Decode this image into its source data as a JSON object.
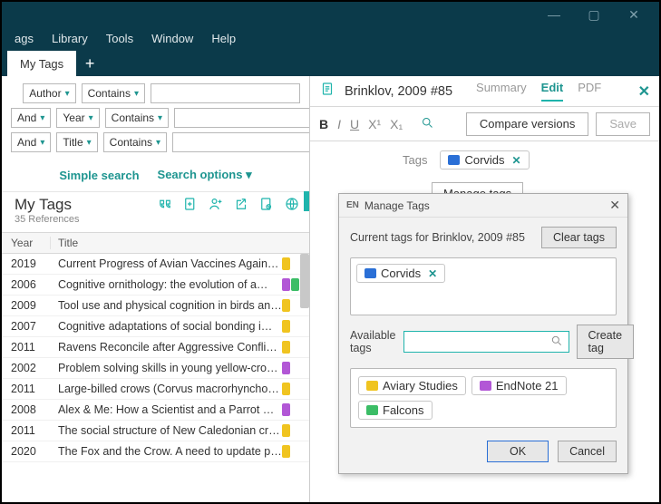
{
  "window_controls": {
    "min": "—",
    "max": "▢",
    "close": "✕"
  },
  "menubar": [
    "ags",
    "Library",
    "Tools",
    "Window",
    "Help"
  ],
  "tabs": {
    "active": "My Tags",
    "add": "+"
  },
  "search": {
    "rows": [
      {
        "op": "",
        "field": "Author",
        "cond": "Contains",
        "value": ""
      },
      {
        "op": "And",
        "field": "Year",
        "cond": "Contains",
        "value": ""
      },
      {
        "op": "And",
        "field": "Title",
        "cond": "Contains",
        "value": ""
      }
    ],
    "simple_label": "Simple search",
    "options_label": "Search options"
  },
  "group": {
    "title": "My Tags",
    "count": "35 References"
  },
  "table": {
    "headers": {
      "year": "Year",
      "title": "Title"
    },
    "rows": [
      {
        "year": "2019",
        "title": "Current Progress of Avian Vaccines Against …",
        "tags": [
          "#f0c420"
        ]
      },
      {
        "year": "2006",
        "title": "Cognitive ornithology: the evolution of a…",
        "tags": [
          "#b257d6",
          "#3bbd66"
        ]
      },
      {
        "year": "2009",
        "title": "Tool use and physical cognition in birds and…",
        "tags": [
          "#f0c420"
        ]
      },
      {
        "year": "2007",
        "title": "Cognitive adaptations of social bonding i…",
        "tags": [
          "#f0c420"
        ]
      },
      {
        "year": "2011",
        "title": "Ravens Reconcile after Aggressive Conflicts …",
        "tags": [
          "#f0c420"
        ]
      },
      {
        "year": "2002",
        "title": "Problem solving skills in young yellow-crow…",
        "tags": [
          "#b257d6"
        ]
      },
      {
        "year": "2011",
        "title": "Large-billed crows (Corvus macrorhynchos) …",
        "tags": [
          "#f0c420"
        ]
      },
      {
        "year": "2008",
        "title": "Alex & Me: How a Scientist and a Parrot Dis…",
        "tags": [
          "#b257d6"
        ]
      },
      {
        "year": "2011",
        "title": "The social structure of New Caledonian crows",
        "tags": [
          "#f0c420"
        ]
      },
      {
        "year": "2020",
        "title": "The Fox and the Crow. A need to update pe…",
        "tags": [
          "#f0c420"
        ]
      }
    ]
  },
  "detail": {
    "title": "Brinklov, 2009 #85",
    "tabs": [
      "Summary",
      "Edit",
      "PDF"
    ],
    "active_tab": "Edit",
    "format": {
      "bold": "B",
      "italic": "I",
      "under": "U",
      "sup": "X¹",
      "sub": "X₁"
    },
    "compare": "Compare versions",
    "save": "Save",
    "tags_label": "Tags",
    "current_tag": {
      "label": "Corvids",
      "color": "#2a6fd6"
    },
    "manage_button": "Manage tags"
  },
  "dialog": {
    "title": "Manage Tags",
    "current_label": "Current tags for Brinklov, 2009 #85",
    "clear": "Clear tags",
    "current_tags": [
      {
        "label": "Corvids",
        "color": "#2a6fd6"
      }
    ],
    "available_label": "Available tags",
    "search_placeholder": "",
    "create": "Create tag",
    "available_tags": [
      {
        "label": "Aviary Studies",
        "color": "#f0c420"
      },
      {
        "label": "EndNote 21",
        "color": "#b257d6"
      },
      {
        "label": "Falcons",
        "color": "#3bbd66"
      }
    ],
    "ok": "OK",
    "cancel": "Cancel"
  }
}
